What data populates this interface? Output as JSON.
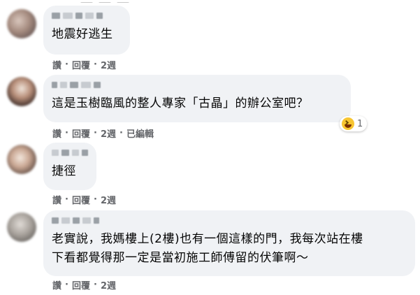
{
  "comments": [
    {
      "text": "地震好逃生",
      "actions": {
        "reply_prefix": "讚",
        "reply": "回覆",
        "time": "2週",
        "edited": ""
      }
    },
    {
      "text": "這是玉樹臨風的整人專家「古晶」的辦公室吧？",
      "actions": {
        "reply_prefix": "讚",
        "reply": "回覆",
        "time": "2週",
        "edited": "已編輯"
      },
      "reaction": {
        "icon": "haha-emoji-icon",
        "count": "1"
      }
    },
    {
      "text": "捷徑",
      "actions": {
        "reply_prefix": "讚",
        "reply": "回覆",
        "time": "2週",
        "edited": ""
      }
    },
    {
      "text_lines": [
        "老實說，我媽樓上(2樓)也有一個這樣的門，我每次站在樓",
        "下看都覺得那一定是當初施工師傅留的伏筆啊～"
      ],
      "actions": {
        "reply_prefix": "讚",
        "reply": "回覆",
        "time": "2週",
        "edited": ""
      }
    }
  ]
}
